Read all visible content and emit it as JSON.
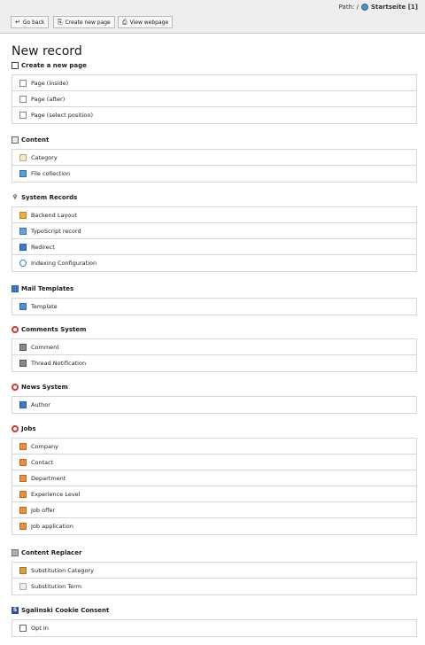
{
  "path": {
    "label": "Path: /",
    "page": "Startseite [1]"
  },
  "toolbar": {
    "go_back": "Go back",
    "create_new_page": "Create new page",
    "view_webpage": "View webpage"
  },
  "title": "New record",
  "sections": {
    "create_page": {
      "heading": "Create a new page",
      "items": [
        "Page (inside)",
        "Page (after)",
        "Page (select position)"
      ]
    },
    "content": {
      "heading": "Content",
      "items": [
        "Category",
        "File collection"
      ]
    },
    "system_records": {
      "heading": "System Records",
      "items": [
        "Backend Layout",
        "TypoScript record",
        "Redirect",
        "Indexing Configuration"
      ]
    },
    "mail_templates": {
      "heading": "Mail Templates",
      "items": [
        "Template"
      ]
    },
    "comments_system": {
      "heading": "Comments System",
      "items": [
        "Comment",
        "Thread Notification"
      ]
    },
    "news_system": {
      "heading": "News System",
      "items": [
        "Author"
      ]
    },
    "jobs": {
      "heading": "Jobs",
      "items": [
        "Company",
        "Contact",
        "Department",
        "Experience Level",
        "Job offer",
        "Job application"
      ]
    },
    "content_replacer": {
      "heading": "Content Replacer",
      "items": [
        "Substitution Category",
        "Substitution Term"
      ]
    },
    "cookie_consent": {
      "heading": "Sgalinski Cookie Consent",
      "items": [
        "Opt In"
      ]
    }
  }
}
